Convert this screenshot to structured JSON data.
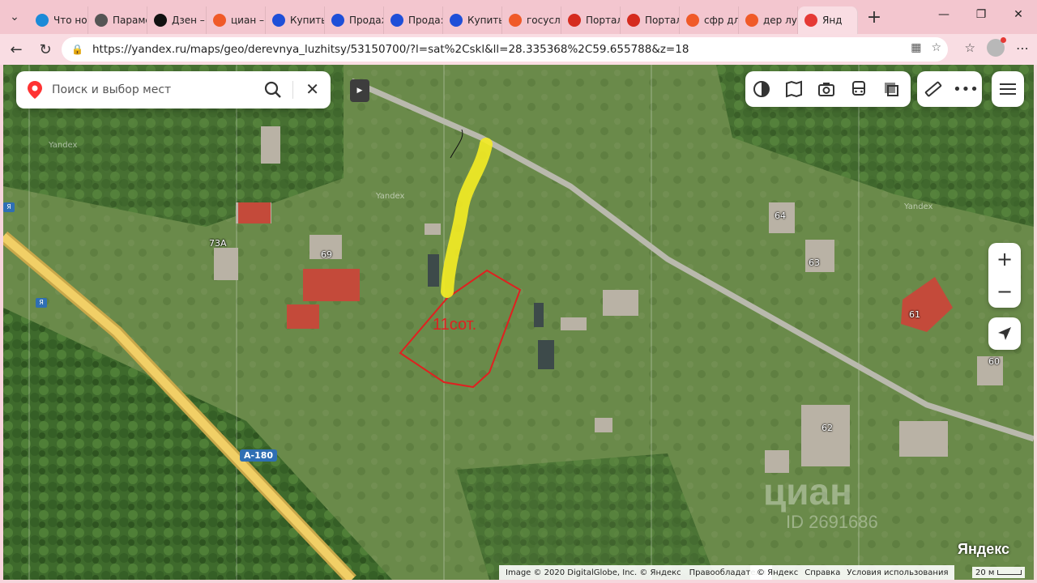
{
  "browser": {
    "tabs": [
      {
        "label": "Что нов",
        "icon": "edge-icon",
        "color": "#1b8ad8"
      },
      {
        "label": "Парамe",
        "icon": "gear-icon",
        "color": "#555555"
      },
      {
        "label": "Дзен –",
        "icon": "dzen-icon",
        "color": "#111111"
      },
      {
        "label": "циан –",
        "icon": "yandex-icon",
        "color": "#f05a28"
      },
      {
        "label": "Купить",
        "icon": "avito-icon",
        "color": "#1f4fd8"
      },
      {
        "label": "Продаж",
        "icon": "avito-icon",
        "color": "#1f4fd8"
      },
      {
        "label": "Прода:",
        "icon": "avito-icon",
        "color": "#1f4fd8"
      },
      {
        "label": "Купить",
        "icon": "avito-icon",
        "color": "#1f4fd8"
      },
      {
        "label": "госуслу",
        "icon": "yandex-icon",
        "color": "#f05a28"
      },
      {
        "label": "Портал",
        "icon": "flag-icon",
        "color": "#d52b1e"
      },
      {
        "label": "Портал",
        "icon": "flag-icon",
        "color": "#d52b1e"
      },
      {
        "label": "сфр дл:",
        "icon": "yandex-icon",
        "color": "#f05a28"
      },
      {
        "label": "дер луж",
        "icon": "yandex-icon",
        "color": "#f05a28"
      },
      {
        "label": "Янд",
        "icon": "maps-pin-icon",
        "color": "#e53935"
      }
    ],
    "url": "https://yandex.ru/maps/geo/derevnya_luzhitsy/53150700/?l=sat%2Cskl&ll=28.335368%2C59.655788&z=18"
  },
  "map": {
    "search_placeholder": "Поиск и выбор мест",
    "plot_label": "11сот.",
    "road_label": "А-180",
    "house_labels": [
      "73А",
      "69",
      "64",
      "63",
      "61",
      "60",
      "62"
    ],
    "map_watermark": "Yandex",
    "cian_watermark": "циан",
    "cian_id": "ID 2691686",
    "footer_left": [
      "Image © 2020 DigitalGlobe, Inc. © Яндекс",
      "Правообладатели"
    ],
    "footer_right": [
      "© Яндекс",
      "Справка",
      "Условия использования"
    ],
    "brand": "Яндекс",
    "scale": "20 м",
    "zoom_in": "+",
    "zoom_out": "−"
  }
}
